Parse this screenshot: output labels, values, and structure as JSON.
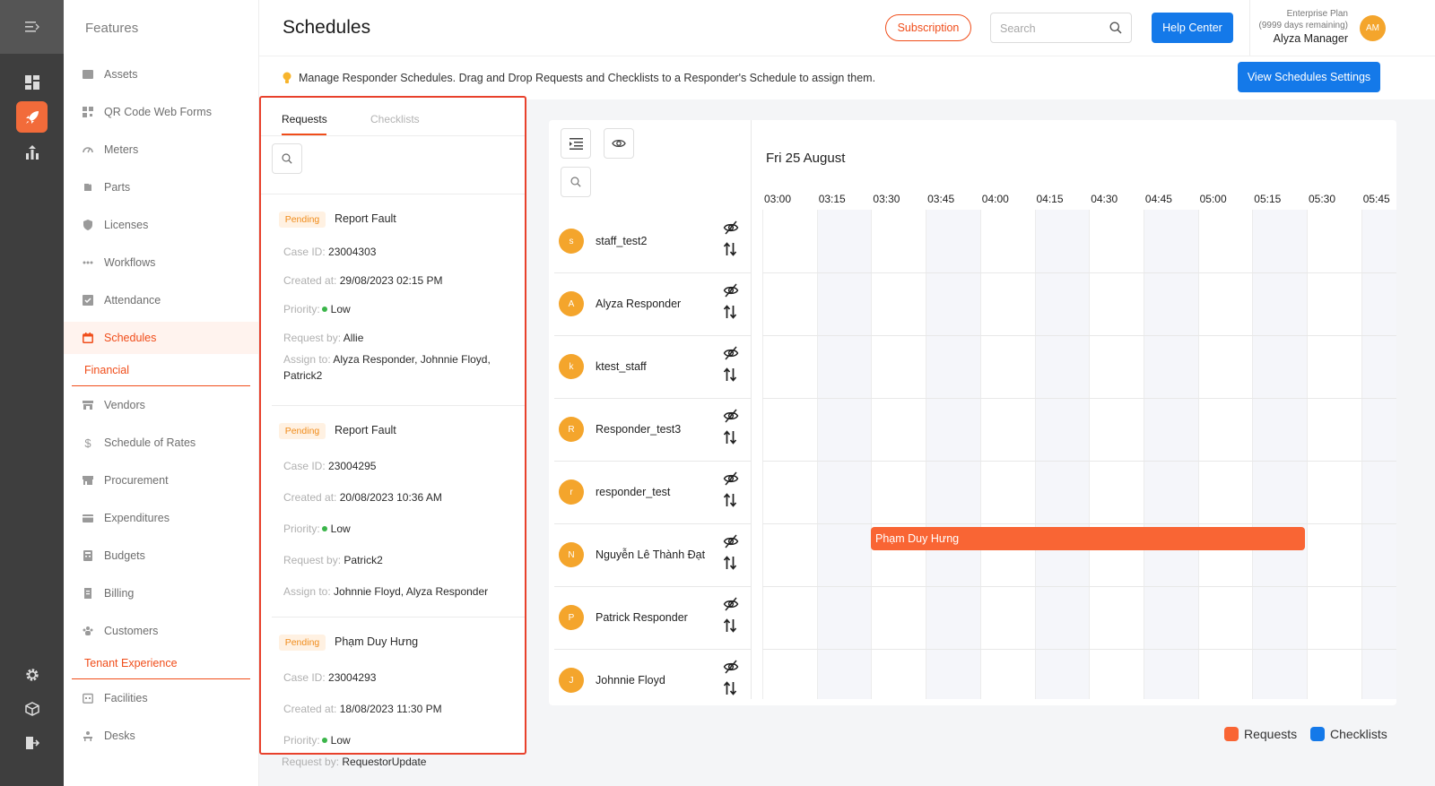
{
  "sidebar": {
    "title": "Features",
    "items": [
      {
        "label": "Assets",
        "icon": "assets-icon"
      },
      {
        "label": "QR Code Web Forms",
        "icon": "qr-code-icon"
      },
      {
        "label": "Meters",
        "icon": "meter-icon"
      },
      {
        "label": "Parts",
        "icon": "parts-icon"
      },
      {
        "label": "Licenses",
        "icon": "license-icon"
      },
      {
        "label": "Workflows",
        "icon": "workflow-icon"
      },
      {
        "label": "Attendance",
        "icon": "attendance-icon"
      },
      {
        "label": "Schedules",
        "icon": "calendar-icon"
      }
    ],
    "financial_heading": "Financial",
    "financial_items": [
      {
        "label": "Vendors",
        "icon": "vendor-icon"
      },
      {
        "label": "Schedule of Rates",
        "icon": "dollar-icon"
      },
      {
        "label": "Procurement",
        "icon": "procurement-icon"
      },
      {
        "label": "Expenditures",
        "icon": "expenditure-icon"
      },
      {
        "label": "Budgets",
        "icon": "budget-icon"
      },
      {
        "label": "Billing",
        "icon": "billing-icon"
      },
      {
        "label": "Customers",
        "icon": "customers-icon"
      }
    ],
    "tenant_heading": "Tenant Experience",
    "tenant_items": [
      {
        "label": "Facilities",
        "icon": "facilities-icon"
      },
      {
        "label": "Desks",
        "icon": "desk-icon"
      }
    ]
  },
  "header": {
    "title": "Schedules",
    "subscription_label": "Subscription",
    "search_placeholder": "Search",
    "help_label": "Help Center",
    "plan_name": "Enterprise Plan",
    "plan_days": "(9999 days remaining)",
    "user_name": "Alyza Manager",
    "user_initials": "AM"
  },
  "info": {
    "text": "Manage Responder Schedules. Drag and Drop Requests and Checklists to a Responder's Schedule to assign them.",
    "view_settings_label": "View Schedules Settings"
  },
  "requests_panel": {
    "tabs": [
      "Requests",
      "Checklists"
    ],
    "labels": {
      "case_id": "Case ID:",
      "created_at": "Created at:",
      "priority": "Priority:",
      "request_by": "Request by:",
      "assign_to": "Assign to:"
    },
    "cards": [
      {
        "status": "Pending",
        "title": "Report Fault",
        "case_id": "23004303",
        "created_at": "29/08/2023 02:15 PM",
        "priority": "Low",
        "request_by": "Allie",
        "assign_to": "Alyza Responder, Johnnie Floyd, Patrick2"
      },
      {
        "status": "Pending",
        "title": "Report Fault",
        "case_id": "23004295",
        "created_at": "20/08/2023 10:36 AM",
        "priority": "Low",
        "request_by": "Patrick2",
        "assign_to": "Johnnie Floyd, Alyza Responder"
      },
      {
        "status": "Pending",
        "title": "Phạm Duy Hưng",
        "case_id": "23004293",
        "created_at": "18/08/2023 11:30 PM",
        "priority": "Low",
        "request_by": "RequestorUpdate"
      }
    ]
  },
  "schedule": {
    "date": "Fri 25 August",
    "times": [
      "03:00",
      "03:15",
      "03:30",
      "03:45",
      "04:00",
      "04:15",
      "04:30",
      "04:45",
      "05:00",
      "05:15",
      "05:30",
      "05:45"
    ],
    "responders": [
      {
        "initial": "s",
        "name": "staff_test2"
      },
      {
        "initial": "A",
        "name": "Alyza Responder"
      },
      {
        "initial": "k",
        "name": "ktest_staff"
      },
      {
        "initial": "R",
        "name": "Responder_test3"
      },
      {
        "initial": "r",
        "name": "responder_test"
      },
      {
        "initial": "N",
        "name": "Nguyễn Lê Thành Đạt"
      },
      {
        "initial": "P",
        "name": "Patrick Responder"
      },
      {
        "initial": "J",
        "name": "Johnnie Floyd"
      }
    ],
    "events": [
      {
        "label": "Phạm Duy Hưng",
        "responder": "Nguyễn Lê Thành Đạt",
        "start": "03:30",
        "end": "05:30",
        "type": "Requests"
      }
    ]
  },
  "legend": [
    {
      "label": "Requests",
      "color": "#f96534"
    },
    {
      "label": "Checklists",
      "color": "#1479e9"
    }
  ],
  "colors": {
    "accent": "#f04d1a",
    "primary": "#1479e9",
    "avatar": "#f4a52c",
    "pending": "#f08c1b",
    "priority_low": "#3bb54a"
  }
}
